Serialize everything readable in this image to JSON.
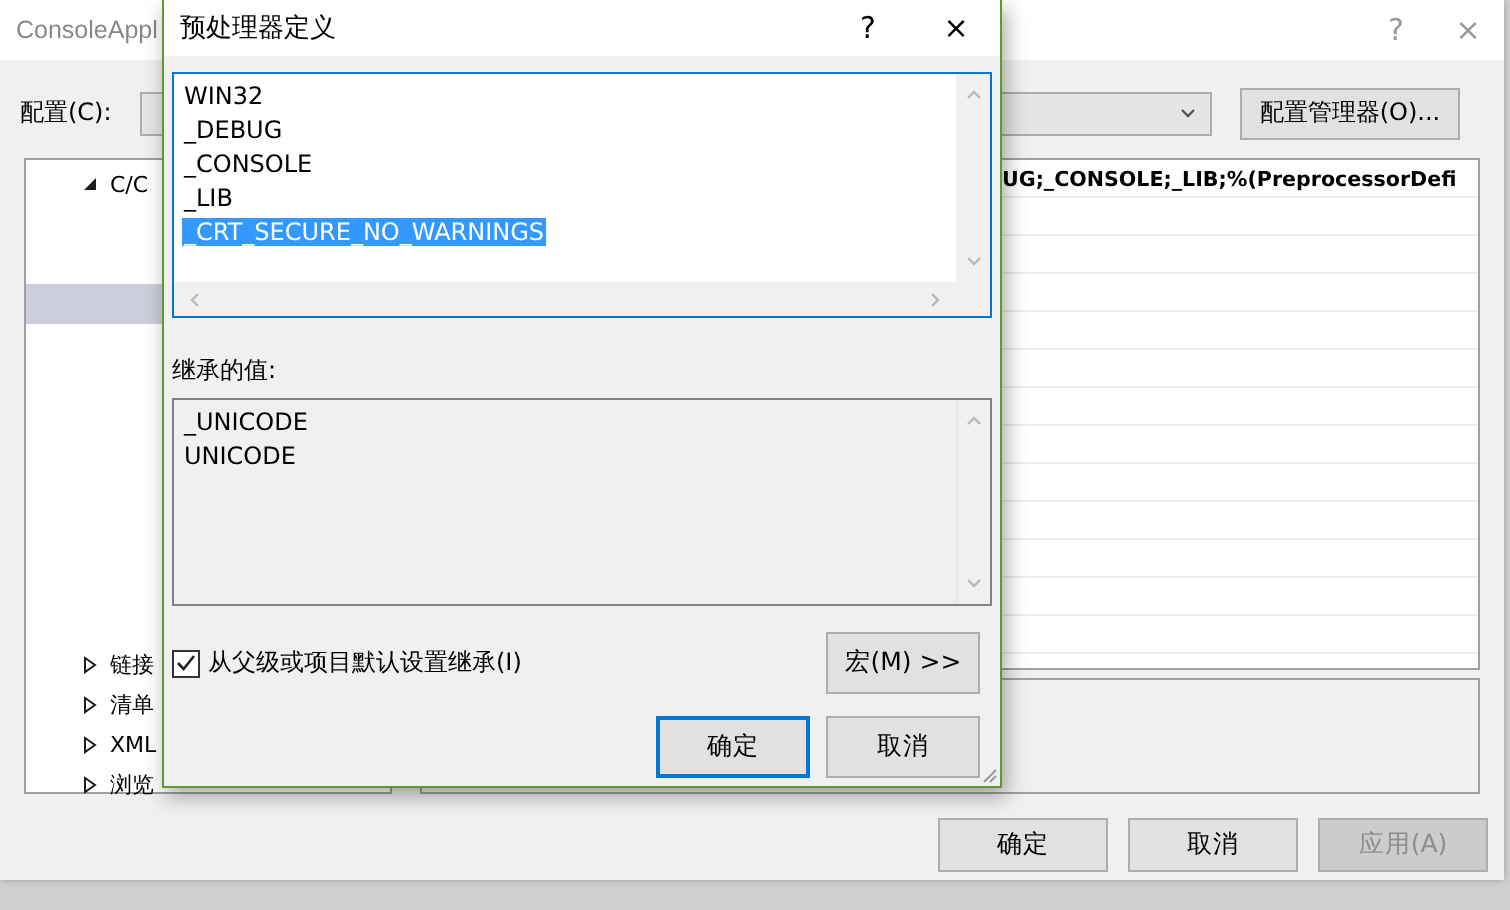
{
  "background_window": {
    "title": "ConsoleAppl",
    "help": "?",
    "close": "×",
    "config_label": "配置(C):",
    "config_manager_button": "配置管理器(O)...",
    "tree": [
      {
        "label": "C/C",
        "expanded": true,
        "selected": false,
        "children": [
          {
            "selected": false
          },
          {
            "selected": false
          },
          {
            "selected": true
          },
          {
            "selected": false
          },
          {
            "selected": false
          },
          {
            "selected": false
          },
          {
            "selected": false
          },
          {
            "selected": false
          },
          {
            "selected": false
          },
          {
            "selected": false
          },
          {
            "selected": false
          }
        ]
      },
      {
        "label": "链接",
        "expanded": false,
        "selected": false
      },
      {
        "label": "清单",
        "expanded": false,
        "selected": false
      },
      {
        "label": "XML",
        "expanded": false,
        "selected": false
      },
      {
        "label": "浏览",
        "expanded": false,
        "selected": false
      }
    ],
    "grid_rows": [
      "UG;_CONSOLE;_LIB;%(PreprocessorDefi"
    ],
    "buttons": [
      {
        "label": "确定",
        "disabled": false
      },
      {
        "label": "取消",
        "disabled": false
      },
      {
        "label": "应用(A)",
        "disabled": true
      }
    ]
  },
  "dialog": {
    "title": "预处理器定义",
    "help": "?",
    "close": "×",
    "definitions": [
      {
        "text": "WIN32",
        "selected": false
      },
      {
        "text": "_DEBUG",
        "selected": false
      },
      {
        "text": "_CONSOLE",
        "selected": false
      },
      {
        "text": "_LIB",
        "selected": false
      },
      {
        "text": "_CRT_SECURE_NO_WARNINGS",
        "selected": true
      }
    ],
    "inherited_label": "继承的值:",
    "inherited_values": [
      "_UNICODE",
      "UNICODE"
    ],
    "inherit_checkbox": {
      "label": "从父级或项目默认设置继承(I)",
      "checked": true
    },
    "macros_button": "宏(M) >>",
    "ok_button": {
      "label": "确定",
      "focused": true
    },
    "cancel_button": "取消"
  }
}
